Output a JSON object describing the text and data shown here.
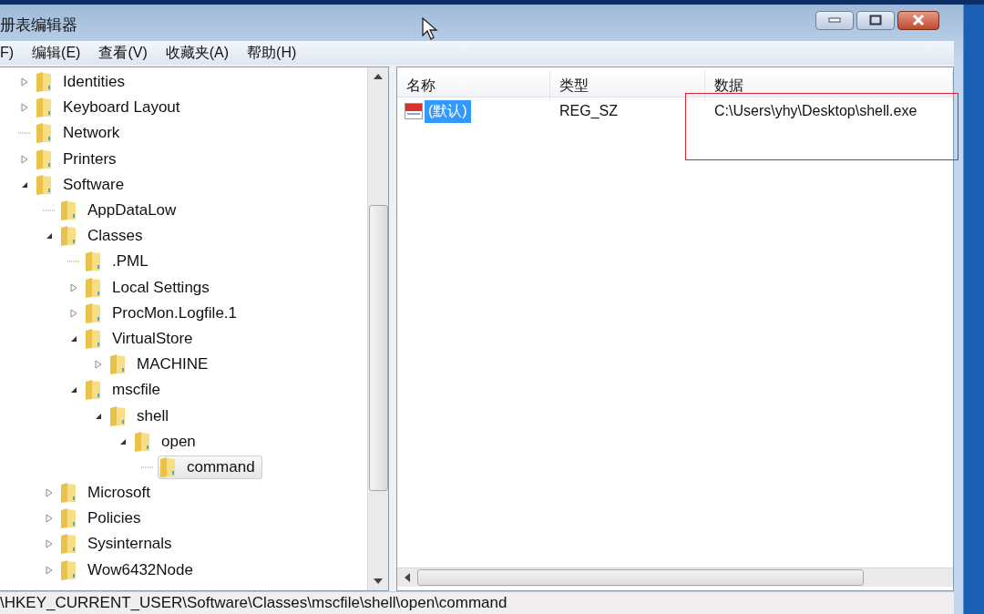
{
  "window": {
    "title": "册表编辑器"
  },
  "menu": [
    "F)",
    "编辑(E)",
    "查看(V)",
    "收藏夹(A)",
    "帮助(H)"
  ],
  "tree": [
    {
      "label": "Identities",
      "expanded": false,
      "selected": false
    },
    {
      "label": "Keyboard Layout",
      "expanded": false,
      "selected": false
    },
    {
      "label": "Network",
      "selected": false
    },
    {
      "label": "Printers",
      "expanded": false,
      "selected": false
    },
    {
      "label": "Software",
      "expanded": true,
      "selected": false,
      "children": [
        {
          "label": "AppDataLow",
          "selected": false
        },
        {
          "label": "Classes",
          "expanded": true,
          "selected": false,
          "children": [
            {
              "label": ".PML",
              "selected": false
            },
            {
              "label": "Local Settings",
              "expanded": false,
              "selected": false
            },
            {
              "label": "ProcMon.Logfile.1",
              "expanded": false,
              "selected": false
            },
            {
              "label": "VirtualStore",
              "expanded": true,
              "selected": false,
              "children": [
                {
                  "label": "MACHINE",
                  "expanded": false,
                  "selected": false
                }
              ]
            },
            {
              "label": "mscfile",
              "expanded": true,
              "selected": false,
              "children": [
                {
                  "label": "shell",
                  "expanded": true,
                  "selected": false,
                  "children": [
                    {
                      "label": "open",
                      "expanded": true,
                      "selected": false,
                      "children": [
                        {
                          "label": "command",
                          "selected": true
                        }
                      ]
                    }
                  ]
                }
              ]
            }
          ]
        },
        {
          "label": "Microsoft",
          "expanded": false,
          "selected": false
        },
        {
          "label": "Policies",
          "expanded": false,
          "selected": false
        },
        {
          "label": "Sysinternals",
          "expanded": false,
          "selected": false
        },
        {
          "label": "Wow6432Node",
          "expanded": false,
          "selected": false
        }
      ]
    }
  ],
  "list": {
    "columns": [
      "名称",
      "类型",
      "数据"
    ],
    "rows": [
      {
        "name": "(默认)",
        "type": "REG_SZ",
        "data": "C:\\Users\\yhy\\Desktop\\shell.exe",
        "selected": true,
        "data_outlined": true
      }
    ]
  },
  "status_bar": "\\HKEY_CURRENT_USER\\Software\\Classes\\mscfile\\shell\\open\\command"
}
